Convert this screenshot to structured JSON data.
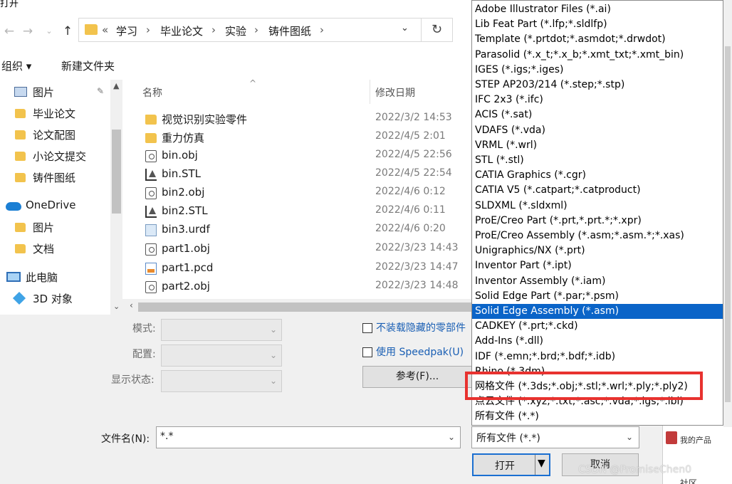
{
  "window": {
    "title": "打开"
  },
  "address": {
    "prefix": "«",
    "crumbs": [
      "学习",
      "毕业论文",
      "实验",
      "铸件图纸"
    ],
    "separator": "›"
  },
  "toolbar": {
    "organize": "组织 ▾",
    "new_folder": "新建文件夹"
  },
  "nav_pane": {
    "items": [
      {
        "label": "图片",
        "icon": "pictures-icon"
      },
      {
        "label": "毕业论文",
        "icon": "folder-icon"
      },
      {
        "label": "论文配图",
        "icon": "folder-icon"
      },
      {
        "label": "小论文提交",
        "icon": "folder-icon"
      },
      {
        "label": "铸件图纸",
        "icon": "folder-icon"
      },
      {
        "label": "OneDrive",
        "icon": "onedrive-icon"
      },
      {
        "label": "图片",
        "icon": "folder-icon"
      },
      {
        "label": "文档",
        "icon": "folder-icon"
      },
      {
        "label": "此电脑",
        "icon": "this-pc-icon"
      },
      {
        "label": "3D 对象",
        "icon": "3d-objects-icon"
      }
    ]
  },
  "file_list": {
    "columns": {
      "name": "名称",
      "modified": "修改日期"
    },
    "rows": [
      {
        "name": "视觉识别实验零件",
        "date": "2022/3/2 14:53",
        "kind": "folder"
      },
      {
        "name": "重力仿真",
        "date": "2022/4/5 2:01",
        "kind": "folder"
      },
      {
        "name": "bin.obj",
        "date": "2022/4/5 22:56",
        "kind": "obj"
      },
      {
        "name": "bin.STL",
        "date": "2022/4/5 22:54",
        "kind": "stl"
      },
      {
        "name": "bin2.obj",
        "date": "2022/4/6 0:12",
        "kind": "obj"
      },
      {
        "name": "bin2.STL",
        "date": "2022/4/6 0:11",
        "kind": "stl"
      },
      {
        "name": "bin3.urdf",
        "date": "2022/4/6 0:20",
        "kind": "urdf"
      },
      {
        "name": "part1.obj",
        "date": "2022/3/23 14:43",
        "kind": "obj"
      },
      {
        "name": "part1.pcd",
        "date": "2022/3/23 14:47",
        "kind": "pcd"
      },
      {
        "name": "part2.obj",
        "date": "2022/3/23 14:48",
        "kind": "obj"
      }
    ]
  },
  "options": {
    "mode_label": "模式:",
    "config_label": "配置:",
    "display_state_label": "显示状态:",
    "no_hidden_label": "不装载隐藏的零部件",
    "speedpak_label": "使用 Speedpak(U)",
    "browse_label": "参考(F)..."
  },
  "footer": {
    "filename_label": "文件名(N):",
    "filename_value": "*.*",
    "filetype_value": "所有文件 (*.*)",
    "open_label": "打开",
    "cancel_label": "取消"
  },
  "side_panel": {
    "label": "我的产品",
    "bottom": "社区"
  },
  "file_types": [
    "Adobe Illustrator Files (*.ai)",
    "Lib Feat Part (*.lfp;*.sldlfp)",
    "Template (*.prtdot;*.asmdot;*.drwdot)",
    "Parasolid (*.x_t;*.x_b;*.xmt_txt;*.xmt_bin)",
    "IGES (*.igs;*.iges)",
    "STEP AP203/214 (*.step;*.stp)",
    "IFC 2x3 (*.ifc)",
    "ACIS (*.sat)",
    "VDAFS (*.vda)",
    "VRML (*.wrl)",
    "STL (*.stl)",
    "CATIA Graphics (*.cgr)",
    "CATIA V5 (*.catpart;*.catproduct)",
    "SLDXML (*.sldxml)",
    "ProE/Creo Part (*.prt,*.prt.*;*.xpr)",
    "ProE/Creo Assembly (*.asm;*.asm.*;*.xas)",
    "Unigraphics/NX (*.prt)",
    "Inventor Part (*.ipt)",
    "Inventor Assembly (*.iam)",
    "Solid Edge Part (*.par;*.psm)",
    "Solid Edge Assembly (*.asm)",
    "CADKEY (*.prt;*.ckd)",
    "Add-Ins (*.dll)",
    "IDF (*.emn;*.brd;*.bdf;*.idb)",
    "Rhino (*.3dm)",
    "网格文件 (*.3ds;*.obj;*.stl;*.wrl;*.ply;*.ply2)",
    "点云文件 (*.xyz;*.txt;*.asc;*.vda;*.igs;*.ibl)",
    "所有文件 (*.*)"
  ],
  "selected_file_type_index": 20,
  "watermark": "CSDN @PromiseChen0",
  "colors": {
    "selection": "#0a64c8",
    "annotation": "#e8322f",
    "folder": "#f2c34d"
  }
}
